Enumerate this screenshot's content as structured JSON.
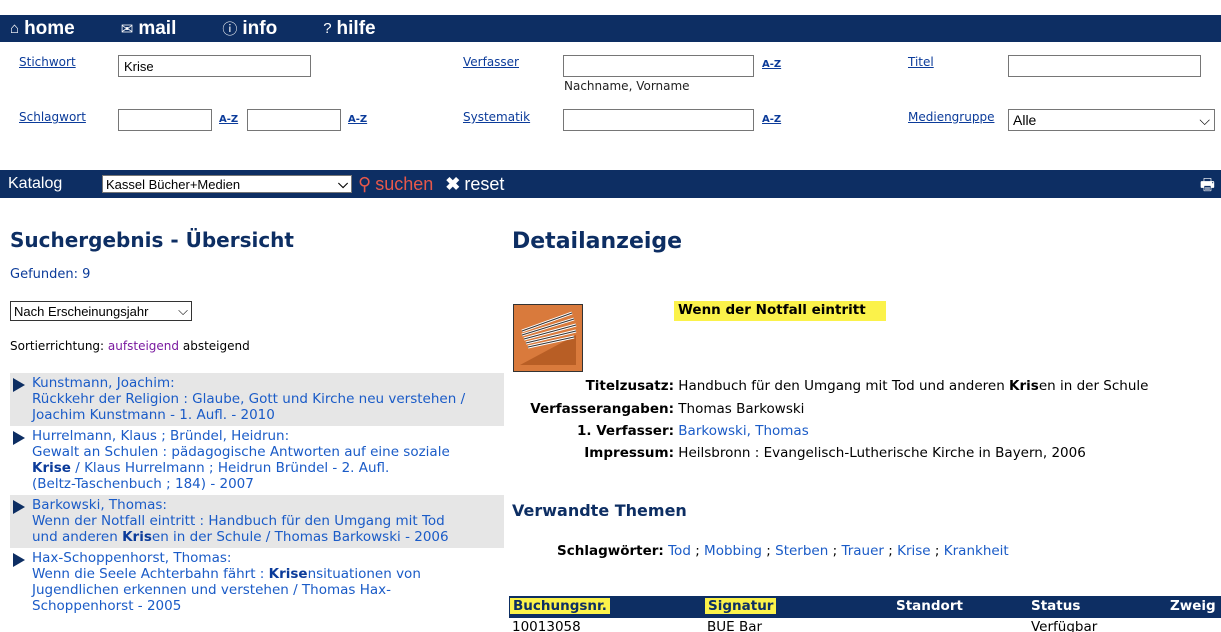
{
  "nav": {
    "items": [
      {
        "icon": "home-icon",
        "glyph": "⌂",
        "label": "home"
      },
      {
        "icon": "mail-icon",
        "glyph": "✉",
        "label": "mail"
      },
      {
        "icon": "info-icon",
        "glyph": "ⓘ",
        "label": "info"
      },
      {
        "icon": "help-icon",
        "glyph": "?",
        "label": "hilfe"
      }
    ]
  },
  "search": {
    "stichwort_label": "Stichwort",
    "stichwort_value": "Krise",
    "verfasser_label": "Verfasser",
    "verfasser_value": "",
    "verfasser_hint": "Nachname, Vorname",
    "titel_label": "Titel",
    "titel_value": "",
    "schlagwort_label": "Schlagwort",
    "schlagwort_value1": "",
    "schlagwort_value2": "",
    "systematik_label": "Systematik",
    "systematik_value": "",
    "mediengruppe_label": "Mediengruppe",
    "mediengruppe_value": "Alle",
    "az_label": "A-Z"
  },
  "catbar": {
    "label": "Katalog",
    "catalog_value": "Kassel Bücher+Medien",
    "suchen_label": "suchen",
    "reset_label": "reset"
  },
  "left": {
    "heading": "Suchergebnis - Übersicht",
    "found": "Gefunden: 9",
    "sort_value": "Nach Erscheinungsjahr",
    "sortdir_label": "Sortierrichtung:",
    "sort_asc": "aufsteigend",
    "sort_desc": "absteigend",
    "results": [
      {
        "line1": "Kunstmann, Joachim:",
        "line2": "Rückkehr der Religion : Glaube, Gott und Kirche neu verstehen /",
        "line3": "Joachim Kunstmann - 1. Aufl. - 2010"
      },
      {
        "line1": "Hurrelmann, Klaus ; Bründel, Heidrun:",
        "line2": "Gewalt an Schulen : pädagogische Antworten auf eine soziale",
        "line3b": "Krise",
        "line3": " / Klaus Hurrelmann ; Heidrun Bründel - 2. Aufl.",
        "line4": "(Beltz-Taschenbuch ; 184) - 2007"
      },
      {
        "line1": "Barkowski, Thomas:",
        "line2": "Wenn der Notfall eintritt : Handbuch für den Umgang mit Tod",
        "line3a": "und anderen ",
        "line3b": "Kris",
        "line3": "en in der Schule / Thomas Barkowski - 2006"
      },
      {
        "line1": "Hax-Schoppenhorst, Thomas:",
        "line2a": "Wenn die Seele Achterbahn fährt : ",
        "line2b": "Krise",
        "line2": "nsituationen von",
        "line3": "Jugendlichen erkennen und verstehen / Thomas Hax-",
        "line4": "Schoppenhorst - 2005"
      }
    ]
  },
  "detail": {
    "heading": "Detailanzeige",
    "title": "Wenn der Notfall eintritt",
    "titelzusatz_label": "Titelzusatz:",
    "titelzusatz_a": "Handbuch für den Umgang mit Tod und anderen ",
    "titelzusatz_b": "Kris",
    "titelzusatz_c": "en in der Schule",
    "verfasserangaben_label": "Verfasserangaben:",
    "verfasserangaben": "Thomas Barkowski",
    "erster_verfasser_label": "1. Verfasser:",
    "erster_verfasser": "Barkowski, Thomas",
    "impressum_label": "Impressum:",
    "impressum": "Heilsbronn : Evangelisch-Lutherische Kirche in Bayern, 2006",
    "verwandte_heading": "Verwandte Themen",
    "schlagwoerter_label": "Schlagwörter:",
    "schlagwoerter": [
      "Tod",
      "Mobbing",
      "Sterben",
      "Trauer",
      "Krise",
      "Krankheit"
    ],
    "separator": ";"
  },
  "holdings": {
    "columns": [
      "Buchungsnr.",
      "Signatur",
      "Standort",
      "Status",
      "Zweig"
    ],
    "rows": [
      {
        "buchungsnr": "10013058",
        "signatur": "BUE Bar",
        "standort": "",
        "status": "Verfügbar"
      }
    ]
  }
}
